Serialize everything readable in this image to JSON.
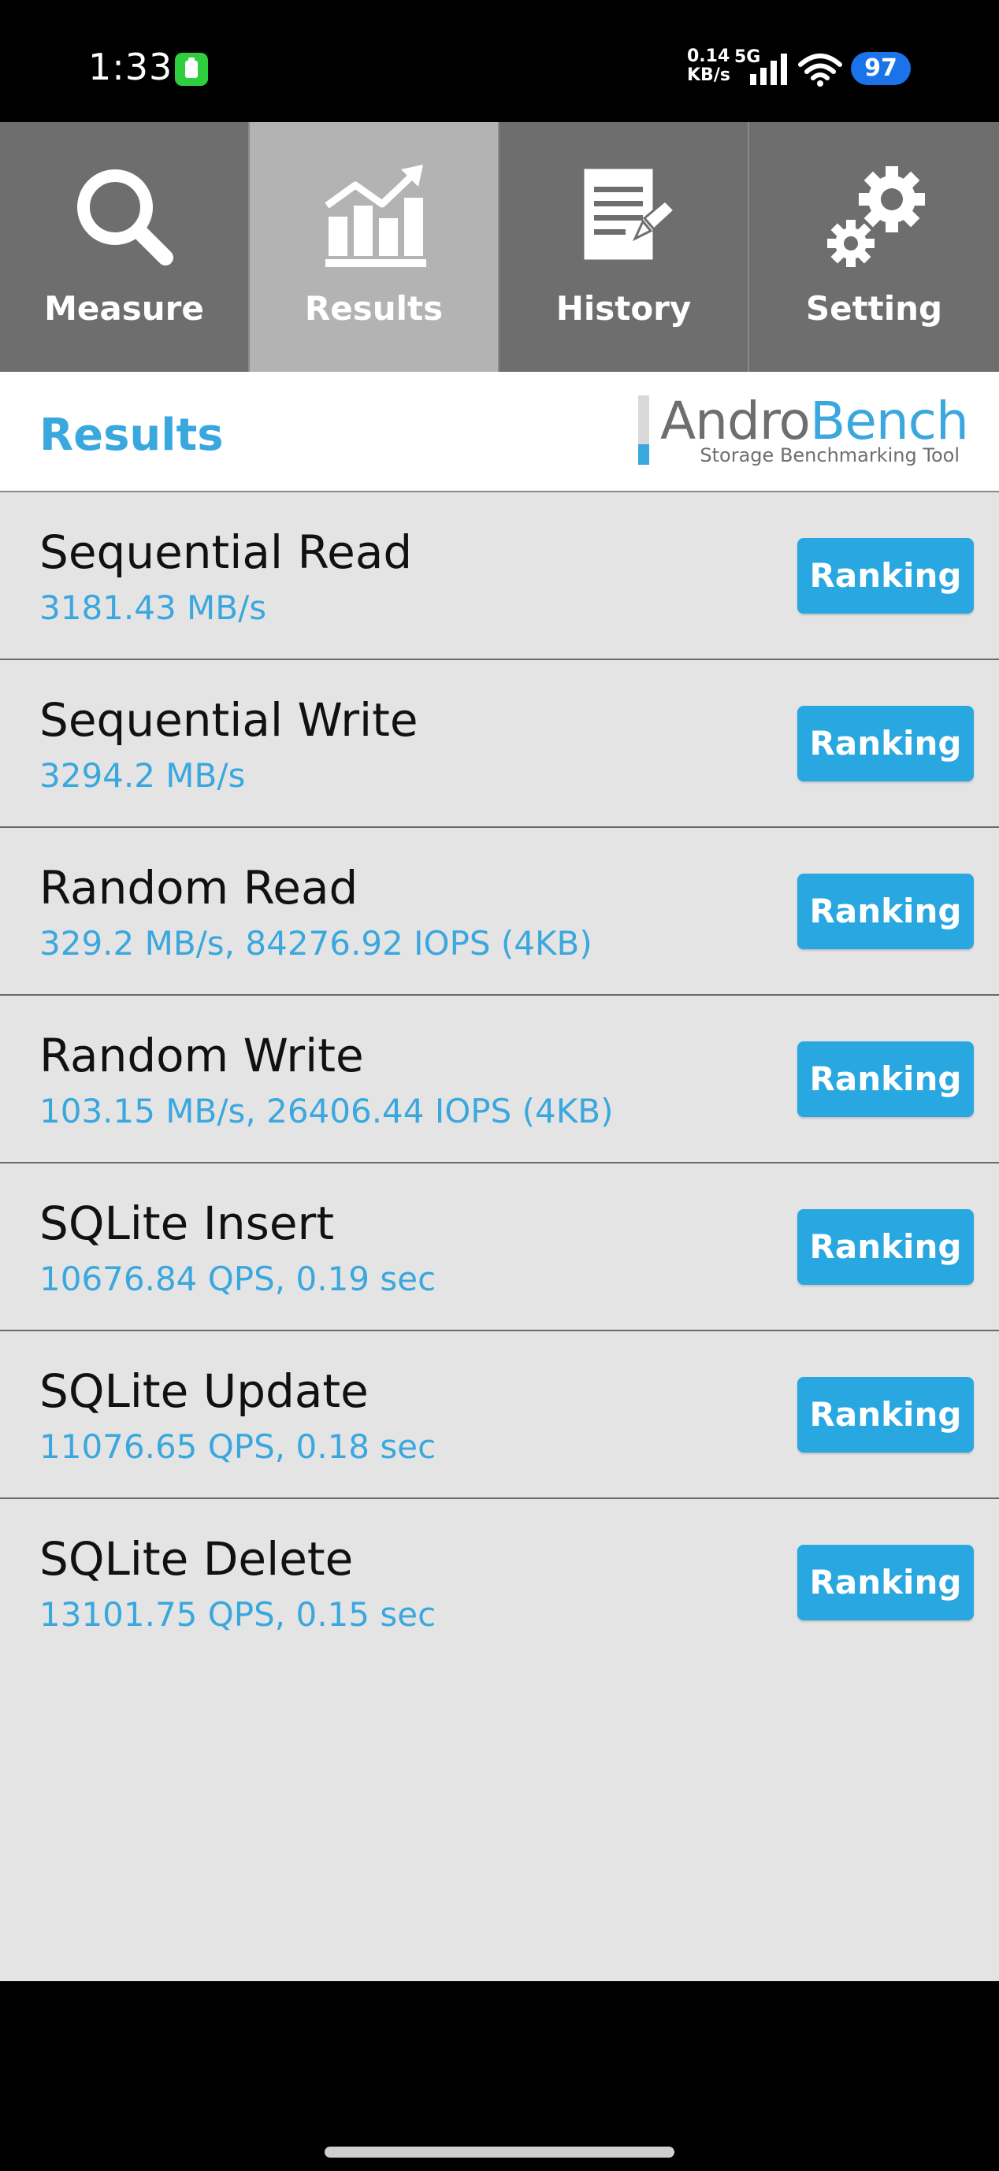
{
  "status_bar": {
    "time": "1:33",
    "net_speed_value": "0.14",
    "net_speed_unit": "KB/s",
    "network_type": "5G",
    "battery_level": "97"
  },
  "tabs": [
    {
      "label": "Measure",
      "icon": "magnifier-icon"
    },
    {
      "label": "Results",
      "icon": "chart-icon"
    },
    {
      "label": "History",
      "icon": "document-icon"
    },
    {
      "label": "Setting",
      "icon": "gears-icon"
    }
  ],
  "active_tab": "Results",
  "header": {
    "title": "Results",
    "logo_andro": "Andro",
    "logo_bench": "Bench",
    "logo_subtitle": "Storage Benchmarking Tool"
  },
  "results": [
    {
      "name": "Sequential Read",
      "value": "3181.43 MB/s",
      "button": "Ranking"
    },
    {
      "name": "Sequential Write",
      "value": "3294.2 MB/s",
      "button": "Ranking"
    },
    {
      "name": "Random Read",
      "value": "329.2 MB/s, 84276.92 IOPS (4KB)",
      "button": "Ranking"
    },
    {
      "name": "Random Write",
      "value": "103.15 MB/s, 26406.44 IOPS (4KB)",
      "button": "Ranking"
    },
    {
      "name": "SQLite Insert",
      "value": "10676.84 QPS, 0.19 sec",
      "button": "Ranking"
    },
    {
      "name": "SQLite Update",
      "value": "11076.65 QPS, 0.18 sec",
      "button": "Ranking"
    },
    {
      "name": "SQLite Delete",
      "value": "13101.75 QPS, 0.15 sec",
      "button": "Ranking"
    }
  ],
  "colors": {
    "accent": "#3aa8de",
    "button": "#29a7e1",
    "tab_bg": "#6e6e6e",
    "tab_active_bg": "#b3b3b3",
    "list_bg": "#e4e4e4"
  }
}
